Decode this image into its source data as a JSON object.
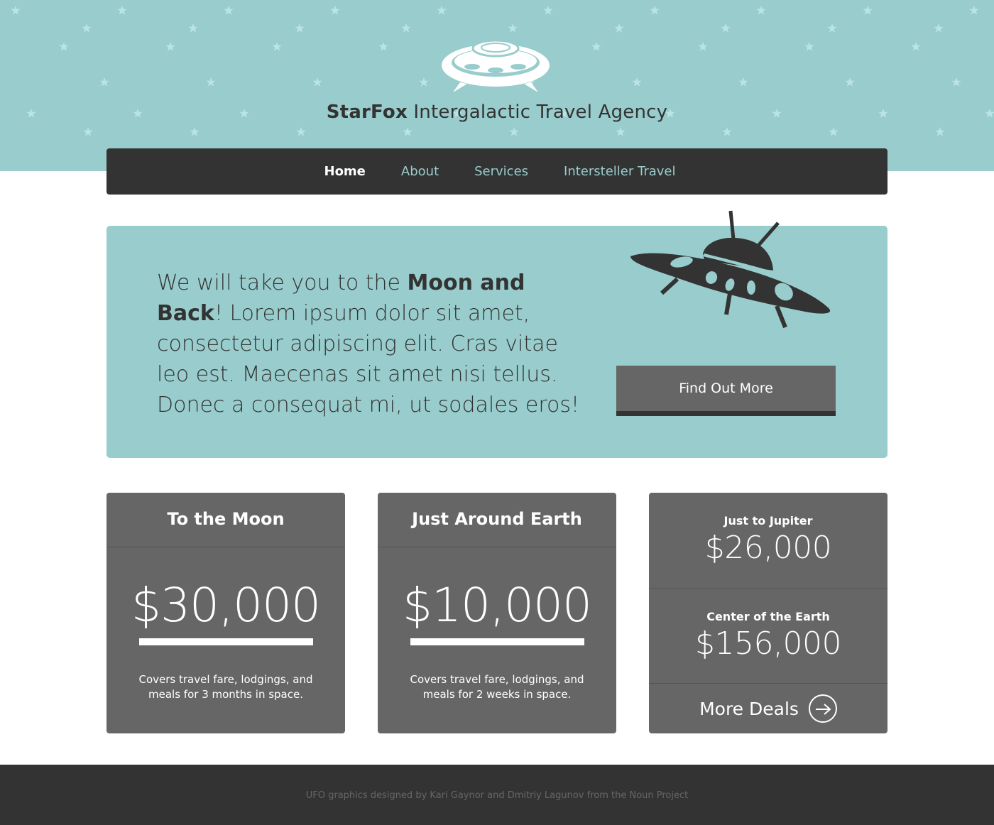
{
  "header": {
    "brand_bold": "StarFox",
    "brand_rest": " Intergalactic Travel Agency",
    "logo_icon": "ufo-icon"
  },
  "nav": {
    "items": [
      {
        "label": "Home",
        "active": true
      },
      {
        "label": "About",
        "active": false
      },
      {
        "label": "Services",
        "active": false
      },
      {
        "label": "Intersteller Travel",
        "active": false
      }
    ]
  },
  "hero": {
    "text_lead": "We will take you to the ",
    "text_bold": "Moon and Back",
    "text_after": "!",
    "text_body": "Lorem ipsum dolor sit amet, consectetur adipiscing elit. Cras vitae leo est. Maecenas sit amet nisi tellus. Donec a consequat mi, ut sodales eros!",
    "cta_label": "Find Out More",
    "illustration_icon": "flying-saucer-icon"
  },
  "cards": [
    {
      "title": "To the Moon",
      "price": "$30,000",
      "description": "Covers travel fare, lodgings, and meals for 3 months in space."
    },
    {
      "title": "Just Around Earth",
      "price": "$10,000",
      "description": "Covers travel fare, lodgings, and meals for 2 weeks in space."
    }
  ],
  "deals": {
    "items": [
      {
        "name": "Just to Jupiter",
        "price": "$26,000"
      },
      {
        "name": "Center of the Earth",
        "price": "$156,000"
      }
    ],
    "more_label": "More Deals",
    "more_icon": "arrow-right-circle-icon"
  },
  "footer": {
    "credit": "UFO graphics designed by Kari Gaynor and Dmitriy Lagunov from the Noun Project"
  },
  "colors": {
    "sky": "#99cccc",
    "dark": "#333333",
    "card": "#666666",
    "nav_link": "#99cccc",
    "star": "#b9e4e4"
  }
}
